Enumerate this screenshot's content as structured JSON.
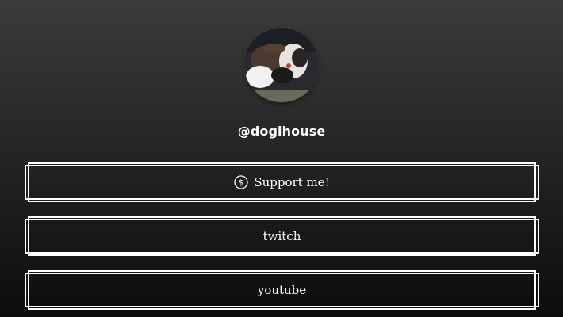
{
  "profile": {
    "handle": "@dogihouse",
    "avatar_icon": "dog-photo-avatar"
  },
  "links": [
    {
      "label": "Support me!",
      "icon": "dollar-circle-icon"
    },
    {
      "label": "twitch"
    },
    {
      "label": "youtube"
    }
  ]
}
